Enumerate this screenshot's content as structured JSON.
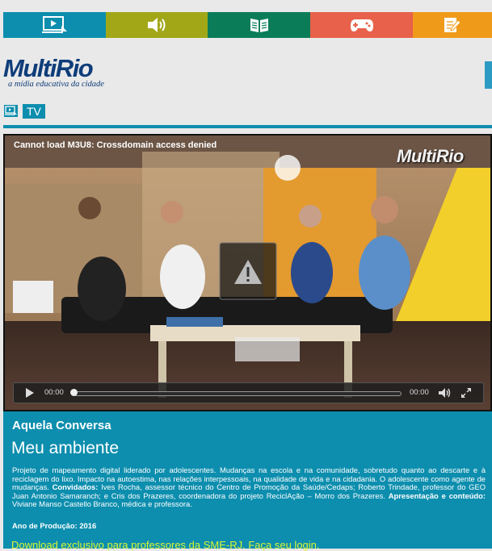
{
  "topbar": {
    "items": [
      {
        "icon": "video-play-icon",
        "color": "#0d8eae"
      },
      {
        "icon": "speaker-icon",
        "color": "#a2a718"
      },
      {
        "icon": "book-icon",
        "color": "#0a7d58"
      },
      {
        "icon": "gamepad-icon",
        "color": "#e8614a"
      },
      {
        "icon": "edit-note-icon",
        "color": "#f09a1a"
      }
    ]
  },
  "logo": {
    "word": "MultiRio",
    "tagline": "a mídia educativa da cidade"
  },
  "section": {
    "label": "TV",
    "icon": "tv-icon"
  },
  "player": {
    "error": "Cannot load M3U8: Crossdomain access denied",
    "watermark": "MultiRio",
    "time_current": "00:00",
    "time_total": "00:00",
    "progress": 0
  },
  "info": {
    "show_title": "Aquela Conversa",
    "episode_title": "Meu ambiente",
    "description_intro": "Projeto de mapeamento digital liderado por adolescentes. Mudanças na escola e na comunidade, sobretudo quanto ao descarte e à reciclagem do lixo. Impacto na autoestima, nas relações interpessoais, na qualidade de vida e na cidadania. O adolescente como agente de mudanças. ",
    "guests_label": "Convidados:",
    "guests_text": " Ives Rocha, assessor técnico do Centro de Promoção da Saúde/Cedaps; Roberto Trindade, professor do GEO Juan Antonio Samaranch; e Cris dos Prazeres, coordenadora do projeto ReciclAção – Morro dos Prazeres. ",
    "presenter_label": "Apresentação e conteúdo:",
    "presenter_text": " Viviane Manso Castello Branco, médica e professora.",
    "year_label": "Ano de Produção: 2016",
    "download_link": "Download exclusivo para professores da SME-RJ. Faça seu login."
  }
}
